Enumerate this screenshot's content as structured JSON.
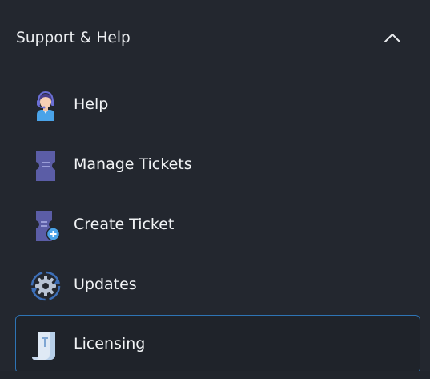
{
  "section": {
    "title": "Support & Help",
    "toggle_icon": "chevron-up-icon",
    "expanded": true
  },
  "menu": {
    "items": [
      {
        "label": "Help",
        "icon": "support-agent-icon",
        "active": false
      },
      {
        "label": "Manage Tickets",
        "icon": "ticket-icon",
        "active": false
      },
      {
        "label": "Create Ticket",
        "icon": "ticket-add-icon",
        "active": false
      },
      {
        "label": "Updates",
        "icon": "gear-update-icon",
        "active": false
      },
      {
        "label": "Licensing",
        "icon": "license-scroll-icon",
        "active": true
      }
    ]
  },
  "colors": {
    "background": "#23272f",
    "active_border": "#2e74b5",
    "ticket_purple": "#5b5da6",
    "accent_blue": "#4aa3e8"
  }
}
